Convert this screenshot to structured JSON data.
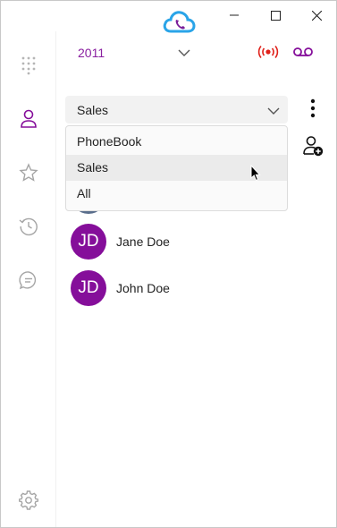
{
  "window": {
    "controls": [
      "minimize",
      "maximize",
      "close"
    ]
  },
  "sidebar": {
    "items": [
      {
        "name": "dialpad",
        "icon": "dialpad-icon"
      },
      {
        "name": "contacts",
        "icon": "contact-icon",
        "active": true
      },
      {
        "name": "favorites",
        "icon": "star-icon"
      },
      {
        "name": "history",
        "icon": "history-icon"
      },
      {
        "name": "chat",
        "icon": "chat-icon"
      },
      {
        "name": "settings",
        "icon": "gear-icon"
      }
    ]
  },
  "header": {
    "extension": "2011",
    "status_icon": "broadcast-icon",
    "voicemail_icon": "voicemail-icon"
  },
  "phonebook_select": {
    "selected": "Sales",
    "options": [
      "PhoneBook",
      "Sales",
      "All"
    ],
    "hovered": "Sales"
  },
  "contacts": [
    {
      "initials": "JD",
      "name": "Jane Doe"
    },
    {
      "initials": "JD",
      "name": "John Doe"
    }
  ],
  "colors": {
    "brand": "#850e9a",
    "accent_red": "#e0221b",
    "icon_gray": "#9a9a9a"
  }
}
